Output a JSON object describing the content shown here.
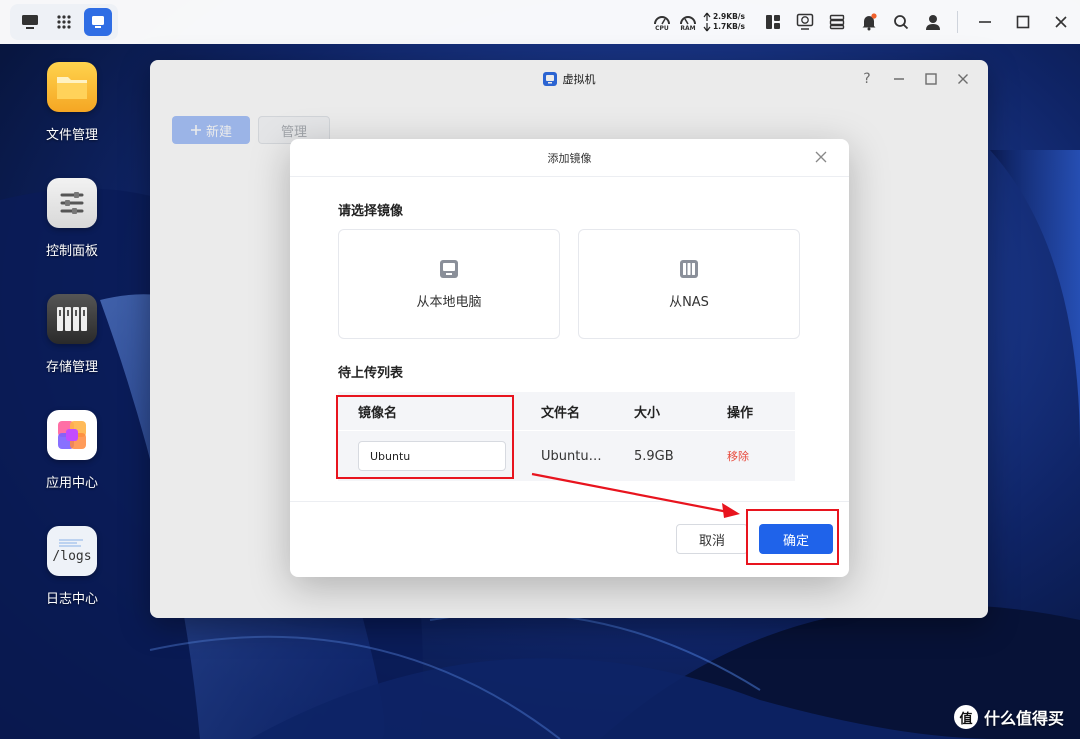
{
  "taskbar": {
    "cpu_label": "CPU",
    "ram_label": "RAM",
    "upload_speed": "2.9KB/s",
    "download_speed": "1.7KB/s"
  },
  "desktop": {
    "icons": [
      {
        "label": "文件管理"
      },
      {
        "label": "控制面板"
      },
      {
        "label": "存储管理"
      },
      {
        "label": "应用中心"
      },
      {
        "label": "日志中心",
        "badge": "/logs"
      }
    ]
  },
  "window": {
    "title": "虚拟机",
    "help": "?",
    "toolbar": {
      "new_label": "新建",
      "manage_label": "管理"
    }
  },
  "dialog": {
    "title": "添加镜像",
    "select_title": "请选择镜像",
    "sources": [
      {
        "label": "从本地电脑",
        "icon": "monitor-icon"
      },
      {
        "label": "从NAS",
        "icon": "nas-icon"
      }
    ],
    "upload_title": "待上传列表",
    "table": {
      "headers": [
        "镜像名",
        "文件名",
        "大小",
        "操作"
      ],
      "rows": [
        {
          "image_name": "Ubuntu",
          "file_name": "Ubuntu…",
          "size": "5.9GB",
          "action": "移除"
        }
      ]
    },
    "cancel_label": "取消",
    "confirm_label": "确定"
  },
  "watermark": {
    "logo_char": "值",
    "text": "什么值得买"
  },
  "colors": {
    "accent": "#1f63ea",
    "annotation": "#e8141e",
    "remove": "#e84a3c"
  }
}
